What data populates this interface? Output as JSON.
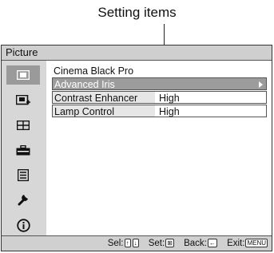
{
  "callout": {
    "label": "Setting items"
  },
  "window": {
    "title": "Picture"
  },
  "sidebar": {
    "icons": [
      {
        "name": "picture-icon",
        "glyph": "▣",
        "active": true
      },
      {
        "name": "picture-advanced-icon",
        "glyph": "▣"
      },
      {
        "name": "screen-icon",
        "glyph": "⊞"
      },
      {
        "name": "setup-icon",
        "glyph": "▬"
      },
      {
        "name": "function-icon",
        "glyph": "☰"
      },
      {
        "name": "installation-wrench-icon",
        "glyph": "🔧"
      },
      {
        "name": "information-icon",
        "glyph": "ⓘ"
      }
    ]
  },
  "menu": {
    "items": [
      {
        "label": "Cinema Black Pro",
        "value": ""
      },
      {
        "label": "Advanced Iris",
        "value": ""
      },
      {
        "label": "Contrast Enhancer",
        "value": "High"
      },
      {
        "label": "Lamp Control",
        "value": "High"
      }
    ]
  },
  "status": {
    "sel_label": "Sel:",
    "sel_keys": [
      "↑",
      "↓"
    ],
    "set_label": "Set:",
    "set_key": "⊞",
    "back_label": "Back:",
    "back_key": "←",
    "exit_label": "Exit:",
    "exit_key": "MENU"
  }
}
